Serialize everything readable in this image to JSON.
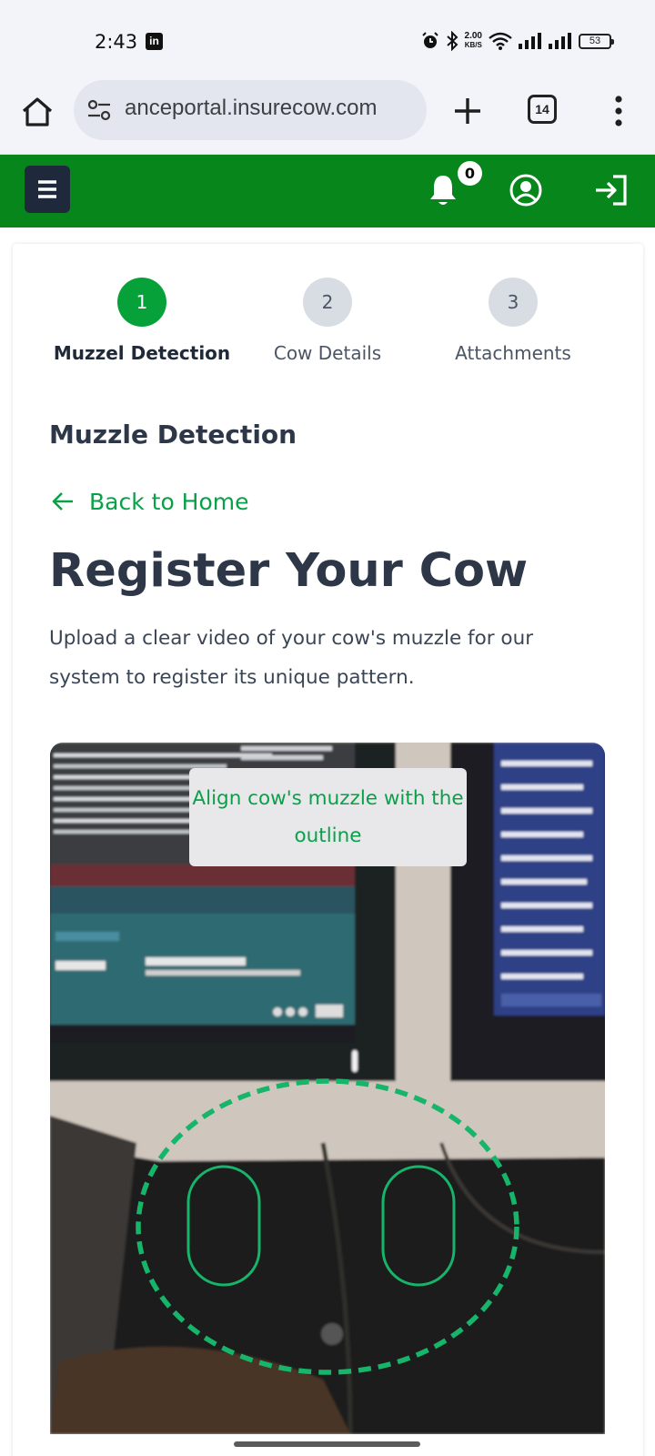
{
  "status_bar": {
    "time": "2:43",
    "linkedin_glyph": "in",
    "net_speed_value": "2.00",
    "net_speed_unit": "KB/S",
    "battery": "53",
    "icons": [
      "linkedin-icon",
      "alarm-icon",
      "bluetooth-icon",
      "wifi-icon",
      "signal-icon",
      "battery-icon"
    ]
  },
  "browser": {
    "url": "anceportal.insurecow.com",
    "tab_count": "14"
  },
  "header": {
    "notification_count": "0",
    "brand_color": "#07861c"
  },
  "steps": [
    {
      "number": "1",
      "label": "Muzzel Detection",
      "active": true
    },
    {
      "number": "2",
      "label": "Cow Details",
      "active": false
    },
    {
      "number": "3",
      "label": "Attachments",
      "active": false
    }
  ],
  "main": {
    "section_title": "Muzzle Detection",
    "back_link": "Back to Home",
    "heading": "Register Your Cow",
    "description": "Upload a clear video of your cow's muzzle for our system to register its unique pattern.",
    "camera_hint": "Align cow's muzzle with the outline",
    "accent_color": "#0aa04a"
  }
}
